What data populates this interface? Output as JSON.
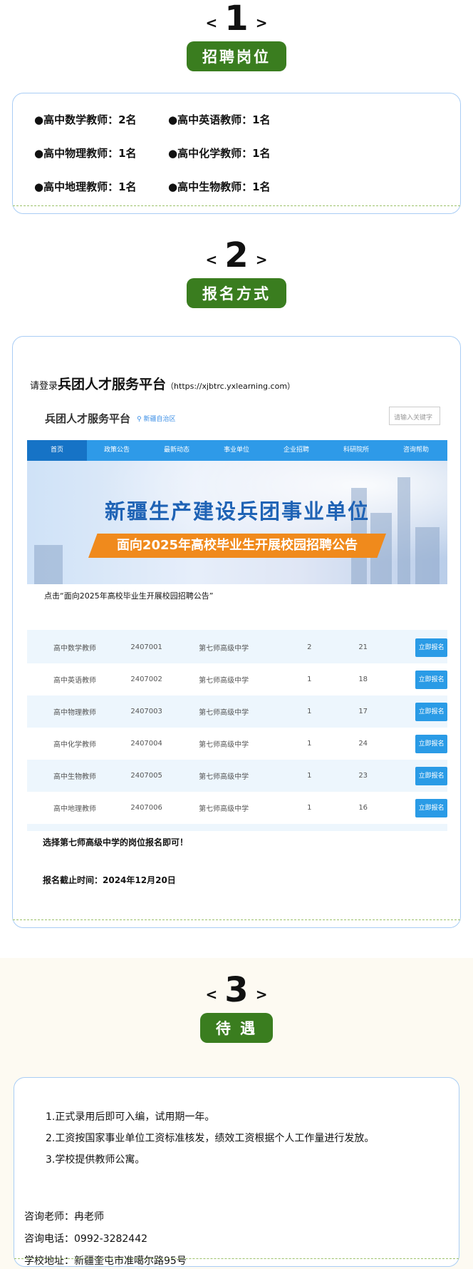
{
  "section1": {
    "left_angle": "<",
    "number": "1",
    "right_angle": ">",
    "badge": "招聘岗位",
    "jobs": [
      "●高中数学教师：2名",
      "●高中英语教师：1名",
      "●高中物理教师：1名",
      "●高中化学教师：1名",
      "●高中地理教师：1名",
      "●高中生物教师：1名"
    ]
  },
  "section2": {
    "left_angle": "<",
    "number": "2",
    "right_angle": ">",
    "badge": "报名方式",
    "intro_prefix": "请登录",
    "intro_platform": "兵团人才服务平台",
    "intro_url": "（https://xjbtrc.yxlearning.com）",
    "screenshot": {
      "logo": "兵团人才服务平台",
      "region": "新疆自治区",
      "search_placeholder": "请输入关键字",
      "nav": [
        "首页",
        "政策公告",
        "最新动态",
        "事业单位",
        "企业招聘",
        "科研院所",
        "咨询帮助"
      ],
      "banner_title": "新疆生产建设兵团事业单位",
      "banner_ribbon": "面向2025年高校毕业生开展校园招聘公告",
      "click_note": "点击“面向2025年高校毕业生开展校园招聘公告”",
      "rows": [
        {
          "post": "高中数学教师",
          "code": "2407001",
          "unit": "第七师高级中学",
          "num": "2",
          "applied": "21",
          "btn": "立即报名"
        },
        {
          "post": "高中英语教师",
          "code": "2407002",
          "unit": "第七师高级中学",
          "num": "1",
          "applied": "18",
          "btn": "立即报名"
        },
        {
          "post": "高中物理教师",
          "code": "2407003",
          "unit": "第七师高级中学",
          "num": "1",
          "applied": "17",
          "btn": "立即报名"
        },
        {
          "post": "高中化学教师",
          "code": "2407004",
          "unit": "第七师高级中学",
          "num": "1",
          "applied": "24",
          "btn": "立即报名"
        },
        {
          "post": "高中生物教师",
          "code": "2407005",
          "unit": "第七师高级中学",
          "num": "1",
          "applied": "23",
          "btn": "立即报名"
        },
        {
          "post": "高中地理教师",
          "code": "2407006",
          "unit": "第七师高级中学",
          "num": "1",
          "applied": "16",
          "btn": "立即报名"
        }
      ]
    },
    "note1": "选择第七师高级中学的岗位报名即可！",
    "deadline": "报名截止时间：2024年12月20日"
  },
  "section3": {
    "left_angle": "<",
    "number": "3",
    "right_angle": ">",
    "badge": "待 遇",
    "benefits": [
      "1.正式录用后即可入编，试用期一年。",
      "2.工资按国家事业单位工资标准核发，绩效工资根据个人工作量进行发放。",
      "3.学校提供教师公寓。"
    ],
    "contact_teacher": "咨询老师：冉老师",
    "contact_phone": "咨询电话：0992-3282442",
    "address": "学校地址：新疆奎屯市准噶尔路95号"
  },
  "colors": {
    "badge_green": "#3a7d1f",
    "card_border": "#a9cdf5",
    "nav_blue": "#2e9ae8",
    "apply_button": "#2a9be6",
    "ribbon_orange": "#f08a1c"
  }
}
